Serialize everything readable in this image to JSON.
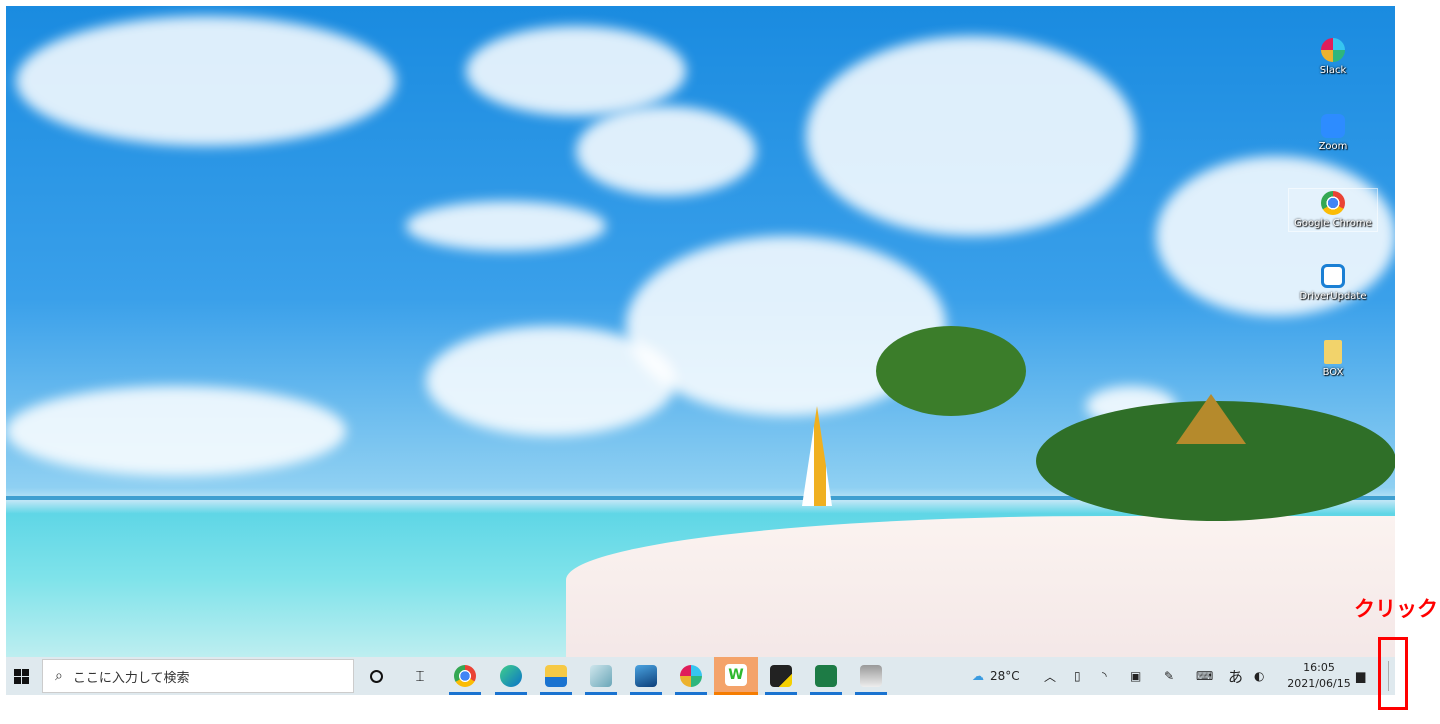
{
  "desktop_icons": [
    {
      "label": "Slack",
      "icon": "slack-icon"
    },
    {
      "label": "Zoom",
      "icon": "zoom-icon"
    },
    {
      "label": "Google Chrome",
      "icon": "chrome-icon"
    },
    {
      "label": "DriverUpdate",
      "icon": "driverupdate-icon"
    },
    {
      "label": "BOX",
      "icon": "folder-icon"
    }
  ],
  "taskbar": {
    "search_placeholder": "ここに入力して検索",
    "apps": [
      "Chrome",
      "Edge",
      "File Explorer",
      "Notepad",
      "Photos",
      "Slack",
      "Word",
      "Sticky Notes",
      "Excel",
      "Snipping"
    ],
    "weather": "28°C",
    "ime": "あ",
    "time": "16:05",
    "date": "2021/06/15"
  },
  "annotation": {
    "label": "クリック",
    "color": "#ff0000"
  }
}
